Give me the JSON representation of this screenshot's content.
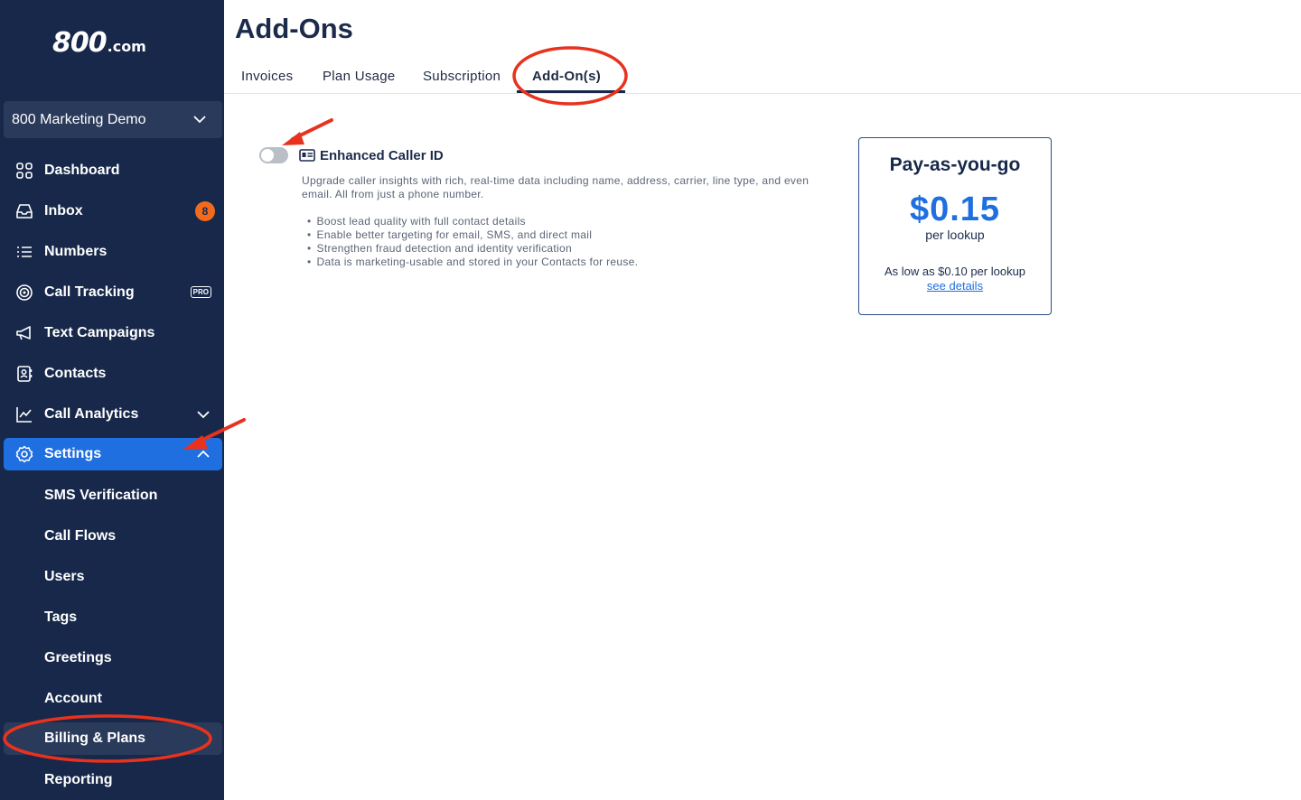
{
  "logo": {
    "main": "800",
    "suffix": ".com"
  },
  "account": {
    "name": "800 Marketing Demo"
  },
  "nav": {
    "dashboard": "Dashboard",
    "inbox": "Inbox",
    "inbox_badge": "8",
    "numbers": "Numbers",
    "call_tracking": "Call Tracking",
    "pro_tag": "PRO",
    "text_campaigns": "Text Campaigns",
    "contacts": "Contacts",
    "call_analytics": "Call Analytics",
    "settings": "Settings",
    "sub": {
      "sms_verification": "SMS Verification",
      "call_flows": "Call Flows",
      "users": "Users",
      "tags": "Tags",
      "greetings": "Greetings",
      "account": "Account",
      "billing_plans": "Billing & Plans",
      "reporting": "Reporting"
    }
  },
  "page": {
    "title": "Add-Ons"
  },
  "tabs": {
    "invoices": "Invoices",
    "plan_usage": "Plan Usage",
    "subscription": "Subscription",
    "addons": "Add-On(s)"
  },
  "addon": {
    "title": "Enhanced Caller ID",
    "enabled": false,
    "description": "Upgrade caller insights with rich, real-time data including name, address, carrier, line type, and even email. All from just a phone number.",
    "bullets": [
      "Boost lead quality with full contact details",
      "Enable better targeting for email, SMS, and direct mail",
      "Strengthen fraud detection and identity verification",
      "Data is marketing-usable and stored in your Contacts for reuse."
    ]
  },
  "pricing": {
    "title": "Pay-as-you-go",
    "price": "$0.15",
    "unit": "per lookup",
    "low": "As low as $0.10 per lookup",
    "link": "see details"
  },
  "colors": {
    "sidebar": "#17284a",
    "accent": "#1f6fe0",
    "badge": "#f26b1d",
    "annotation": "#e8321e"
  }
}
